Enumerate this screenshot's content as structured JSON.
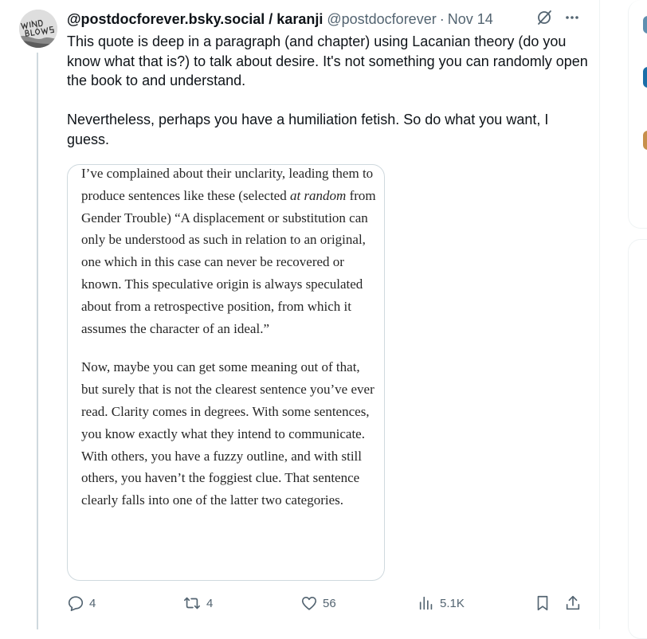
{
  "tweet": {
    "display_name": "@postdocforever.bsky.social / karanji",
    "handle": "@postdocforever",
    "separator": "·",
    "date": "Nov 14",
    "avatar_text": "WIND BLOWS",
    "text_paragraphs": [
      "This quote is deep in a paragraph (and chapter) using Lacanian theory (do you know what that is?) to talk about desire. It's not something you can randomly open the book to and understand.",
      "Nevertheless, perhaps you have a humiliation fetish. So do what you want, I guess."
    ]
  },
  "media": {
    "paragraph1_before_italic": "I’ve complained about their unclarity, leading them to produce sentences like these (selected ",
    "paragraph1_italic": "at random",
    "paragraph1_after_italic": " from Gender Trouble) “A displacement or substitution can only be understood as such in relation to an original, one which in this case can never be recovered or known. This speculative origin is always speculated about from a retrospective position, from which it assumes the character of an ideal.”",
    "paragraph2": "Now, maybe you can get some meaning out of that, but surely that is not the clearest sentence you’ve ever read. Clarity comes in degrees. With some sentences, you know exactly what they intend to communicate. With others, you have a fuzzy outline, and with still others, you haven’t the foggiest clue. That sentence clearly falls into one of the latter two categories."
  },
  "actions": {
    "replies": "4",
    "reposts": "4",
    "likes": "56",
    "views": "5.1K"
  },
  "icons": {
    "grok": "grok-icon",
    "more": "more-icon",
    "reply": "reply-icon",
    "repost": "repost-icon",
    "like": "like-icon",
    "views": "views-icon",
    "bookmark": "bookmark-icon",
    "share": "share-icon"
  },
  "colors": {
    "text": "#0f1419",
    "secondary": "#536471",
    "border": "#cfd9de"
  }
}
